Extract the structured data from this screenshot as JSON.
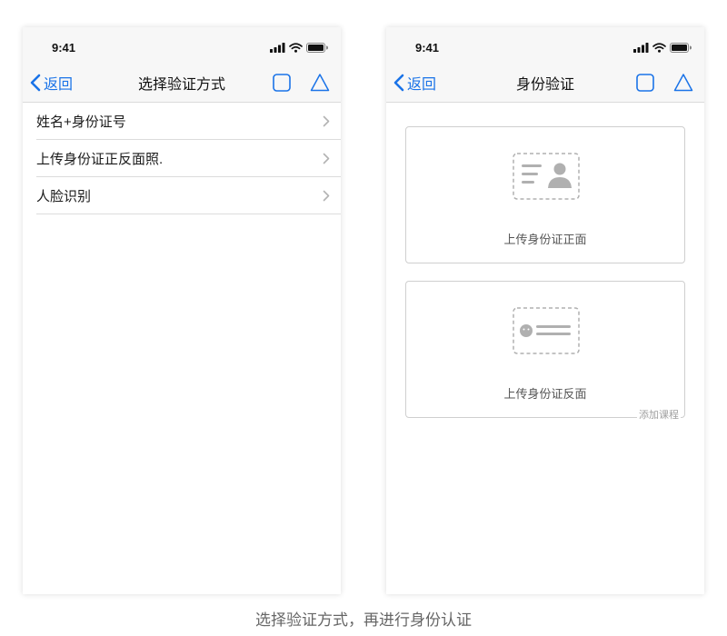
{
  "status_bar": {
    "time": "9:41"
  },
  "left_screen": {
    "back_label": "返回",
    "title": "选择验证方式",
    "menu_items": [
      {
        "label": "姓名+身份证号"
      },
      {
        "label": "上传身份证正反面照."
      },
      {
        "label": "人脸识别"
      }
    ]
  },
  "right_screen": {
    "back_label": "返回",
    "title": "身份验证",
    "cards": [
      {
        "label": "上传身份证正面",
        "icon": "id-card-front-icon"
      },
      {
        "label": "上传身份证反面",
        "icon": "id-card-back-icon"
      }
    ],
    "add_course_label": "添加课程"
  },
  "caption": "选择验证方式，再进行身份认证",
  "colors": {
    "accent": "#1a73e8",
    "nav_background": "#f7f7f7",
    "divider": "#dcdcdc",
    "card_border": "#cfcfcf",
    "placeholder_icon": "#b0b0b0"
  }
}
